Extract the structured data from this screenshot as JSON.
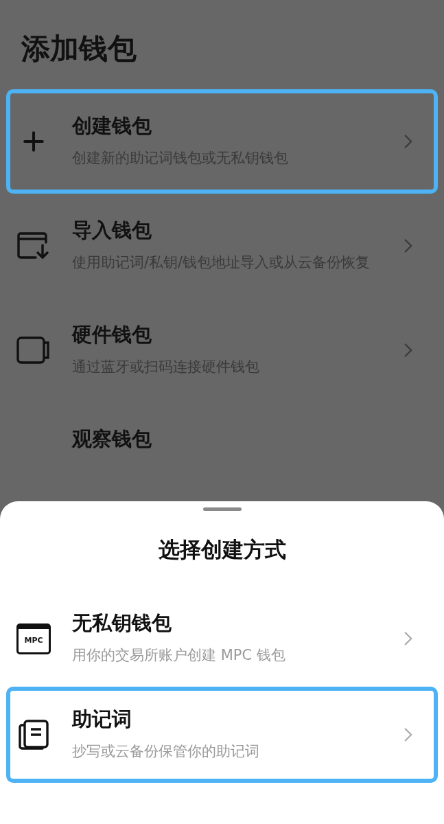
{
  "page": {
    "title": "添加钱包",
    "items": [
      {
        "kind": "plus",
        "title": "创建钱包",
        "subtitle": "创建新的助记词钱包或无私钥钱包",
        "highlighted": true
      },
      {
        "kind": "import",
        "title": "导入钱包",
        "subtitle": "使用助记词/私钥/钱包地址导入或从云备份恢复",
        "highlighted": false
      },
      {
        "kind": "hardware",
        "title": "硬件钱包",
        "subtitle": "通过蓝牙或扫码连接硬件钱包",
        "highlighted": false
      },
      {
        "kind": "watch",
        "title": "观察钱包",
        "highlighted": false
      }
    ]
  },
  "sheet": {
    "title": "选择创建方式",
    "items": [
      {
        "kind": "mpc",
        "icon_text": "MPC",
        "title": "无私钥钱包",
        "subtitle": "用你的交易所账户创建 MPC 钱包",
        "highlighted": false
      },
      {
        "kind": "mnemonic",
        "title": "助记词",
        "subtitle": "抄写或云备份保管你的助记词",
        "highlighted": true
      }
    ]
  }
}
